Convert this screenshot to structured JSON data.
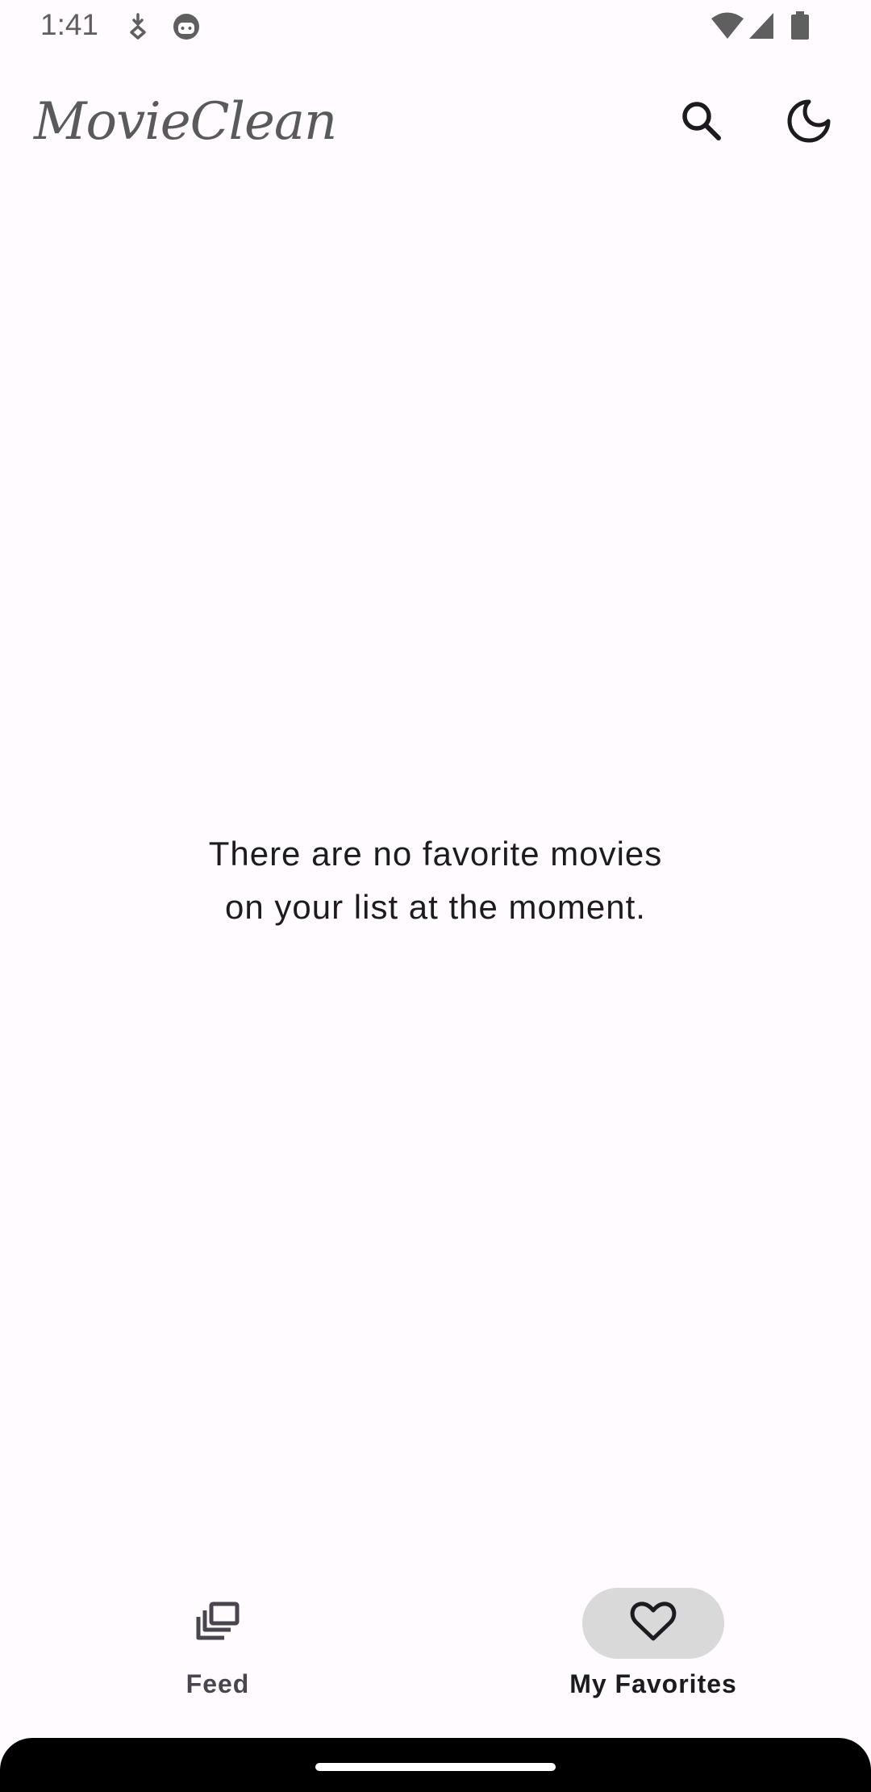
{
  "status_bar": {
    "time": "1:41",
    "icons": [
      "download-notification-icon",
      "android-face-icon",
      "wifi-icon",
      "cellular-signal-icon",
      "battery-icon"
    ]
  },
  "top_bar": {
    "title": "MovieClean",
    "actions": [
      "search-icon",
      "dark-mode-moon-icon"
    ]
  },
  "main": {
    "empty_message": "There are no favorite movies\non your list at the moment."
  },
  "bottom_nav": {
    "items": [
      {
        "label": "Feed",
        "icon": "feed-stack-icon",
        "active": false
      },
      {
        "label": "My Favorites",
        "icon": "heart-outline-icon",
        "active": true
      }
    ]
  },
  "colors": {
    "background": "#fffbfe",
    "active_indicator": "#d9d9d9",
    "text_primary": "#1c1b1f",
    "text_secondary": "#49454f"
  }
}
